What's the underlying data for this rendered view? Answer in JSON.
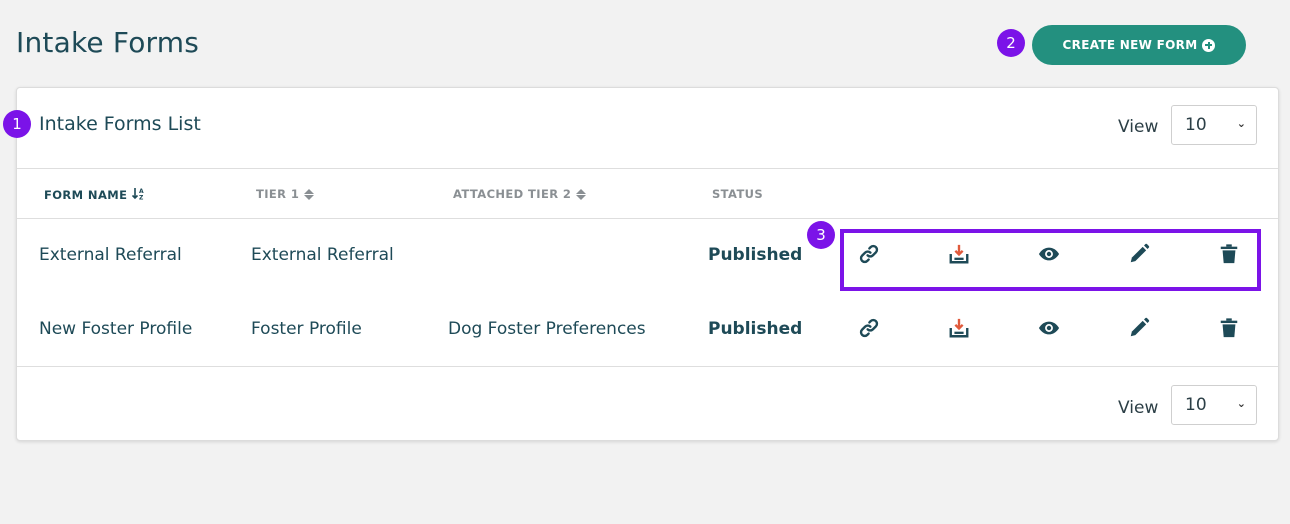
{
  "page": {
    "title": "Intake Forms"
  },
  "annotations": {
    "badge1": "1",
    "badge2": "2",
    "badge3": "3"
  },
  "header": {
    "create_button_label": "CREATE NEW FORM"
  },
  "card": {
    "title": "Intake Forms List",
    "view_label": "View",
    "view_value_top": "10",
    "view_value_bottom": "10"
  },
  "table": {
    "columns": [
      "FORM NAME",
      "TIER 1",
      "ATTACHED TIER 2",
      "STATUS"
    ],
    "sort_az_glyph": "↓ᴬᴢ",
    "rows": [
      {
        "form_name": "External Referral",
        "tier1": "External Referral",
        "tier2": "",
        "status": "Published"
      },
      {
        "form_name": "New Foster Profile",
        "tier1": "Foster Profile",
        "tier2": "Dog Foster Preferences",
        "status": "Published"
      }
    ]
  },
  "icons": [
    "link-icon",
    "download-icon",
    "eye-icon",
    "pencil-icon",
    "trash-icon"
  ],
  "colors": {
    "accent": "#23907f",
    "annotation": "#7b13e8",
    "text": "#1e4a57",
    "download_arrow": "#e05a3c"
  }
}
